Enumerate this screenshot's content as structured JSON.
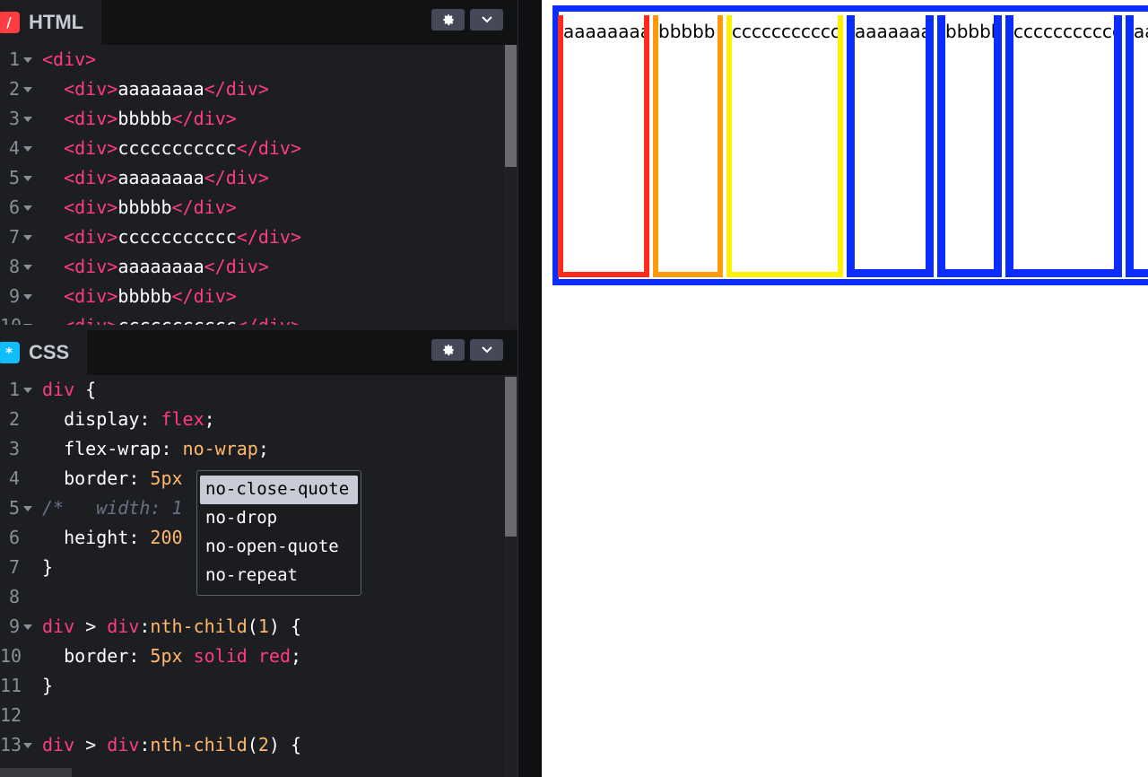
{
  "html_panel": {
    "title": "HTML",
    "badge": "/",
    "badge_color": "#ff3c41",
    "lines": [
      {
        "num": "1",
        "fold": true,
        "indent": "",
        "open": "<div>",
        "text": "",
        "close": ""
      },
      {
        "num": "2",
        "fold": true,
        "indent": "  ",
        "open": "<div>",
        "text": "aaaaaaaa",
        "close": "</div>"
      },
      {
        "num": "3",
        "fold": true,
        "indent": "  ",
        "open": "<div>",
        "text": "bbbbb",
        "close": "</div>"
      },
      {
        "num": "4",
        "fold": true,
        "indent": "  ",
        "open": "<div>",
        "text": "ccccccccccc",
        "close": "</div>"
      },
      {
        "num": "5",
        "fold": true,
        "indent": "  ",
        "open": "<div>",
        "text": "aaaaaaaa",
        "close": "</div>"
      },
      {
        "num": "6",
        "fold": true,
        "indent": "  ",
        "open": "<div>",
        "text": "bbbbb",
        "close": "</div>"
      },
      {
        "num": "7",
        "fold": true,
        "indent": "  ",
        "open": "<div>",
        "text": "ccccccccccc",
        "close": "</div>"
      },
      {
        "num": "8",
        "fold": true,
        "indent": "  ",
        "open": "<div>",
        "text": "aaaaaaaa",
        "close": "</div>"
      },
      {
        "num": "9",
        "fold": true,
        "indent": "  ",
        "open": "<div>",
        "text": "bbbbb",
        "close": "</div>"
      },
      {
        "num": "10",
        "fold": true,
        "indent": "  ",
        "open": "<div>",
        "text": "ccccccccccc",
        "close": "</div>"
      }
    ]
  },
  "css_panel": {
    "title": "CSS",
    "badge": "*",
    "badge_color": "#0ebeff",
    "lines": [
      {
        "num": "1",
        "fold": true,
        "parts": [
          [
            "sel",
            "div"
          ],
          [
            "white",
            " {"
          ]
        ]
      },
      {
        "num": "2",
        "fold": false,
        "parts": [
          [
            "white",
            "  display: "
          ],
          [
            "kw",
            "flex"
          ],
          [
            "white",
            ";"
          ]
        ]
      },
      {
        "num": "3",
        "fold": false,
        "parts": [
          [
            "white",
            "  flex-wrap: "
          ],
          [
            "val",
            "no-wrap"
          ],
          [
            "white",
            ";"
          ]
        ]
      },
      {
        "num": "4",
        "fold": false,
        "parts": [
          [
            "white",
            "  border: "
          ],
          [
            "num",
            "5px"
          ]
        ]
      },
      {
        "num": "5",
        "fold": true,
        "parts": [
          [
            "cmt",
            "/*   width: 1"
          ]
        ]
      },
      {
        "num": "6",
        "fold": false,
        "parts": [
          [
            "white",
            "  height: "
          ],
          [
            "num",
            "200"
          ]
        ]
      },
      {
        "num": "7",
        "fold": false,
        "parts": [
          [
            "white",
            "}"
          ]
        ]
      },
      {
        "num": "8",
        "fold": false,
        "parts": []
      },
      {
        "num": "9",
        "fold": true,
        "parts": [
          [
            "sel",
            "div"
          ],
          [
            "white",
            " > "
          ],
          [
            "sel",
            "div"
          ],
          [
            "white",
            ":"
          ],
          [
            "val",
            "nth-child"
          ],
          [
            "white",
            "("
          ],
          [
            "num",
            "1"
          ],
          [
            "white",
            ") {"
          ]
        ]
      },
      {
        "num": "10",
        "fold": false,
        "parts": [
          [
            "white",
            "  border: "
          ],
          [
            "num",
            "5px"
          ],
          [
            "white",
            " "
          ],
          [
            "kw",
            "solid"
          ],
          [
            "white",
            " "
          ],
          [
            "kw",
            "red"
          ],
          [
            "white",
            ";"
          ]
        ]
      },
      {
        "num": "11",
        "fold": false,
        "parts": [
          [
            "white",
            "}"
          ]
        ]
      },
      {
        "num": "12",
        "fold": false,
        "parts": []
      },
      {
        "num": "13",
        "fold": true,
        "parts": [
          [
            "sel",
            "div"
          ],
          [
            "white",
            " > "
          ],
          [
            "sel",
            "div"
          ],
          [
            "white",
            ":"
          ],
          [
            "val",
            "nth-child"
          ],
          [
            "white",
            "("
          ],
          [
            "num",
            "2"
          ],
          [
            "white",
            ") {"
          ]
        ]
      }
    ]
  },
  "autocomplete": {
    "items": [
      "no-close-quote",
      "no-drop",
      "no-open-quote",
      "no-repeat"
    ],
    "active_index": 0
  },
  "preview": {
    "outer_border_color": "#0a2cff",
    "boxes": [
      {
        "text": "aaaaaaaa",
        "color": "#ff2a1a"
      },
      {
        "text": "bbbbb",
        "color": "#ff9a0a"
      },
      {
        "text": "ccccccccccc",
        "color": "#fff200"
      },
      {
        "text": "aaaaaaaa",
        "color": "#0a2cff"
      },
      {
        "text": "bbbbb",
        "color": "#0a2cff"
      },
      {
        "text": "ccccccccccc",
        "color": "#0a2cff"
      },
      {
        "text": "aaaaaaaa",
        "color": "#0a2cff"
      }
    ]
  }
}
